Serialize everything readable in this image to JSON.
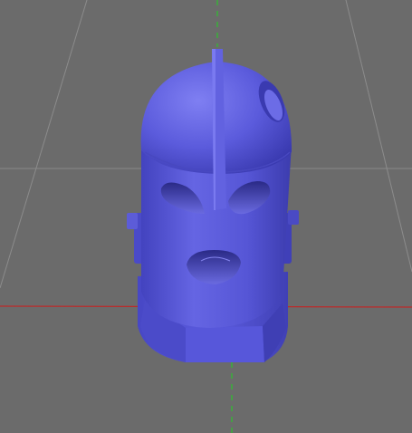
{
  "viewport": {
    "background": "#6b6b6b",
    "grid_color": "#8a8a8a",
    "axis_x_color": "#d11a1a",
    "axis_y_color": "#22d022",
    "model_color": "#5d5dde"
  },
  "model": {
    "object": "helmet-mesh",
    "features": [
      "crest-ridge",
      "side-vent",
      "left-eye-slot",
      "right-eye-slot",
      "mouth-opening",
      "left-ear-bolt",
      "right-ear-bolt",
      "neck-collar"
    ]
  }
}
